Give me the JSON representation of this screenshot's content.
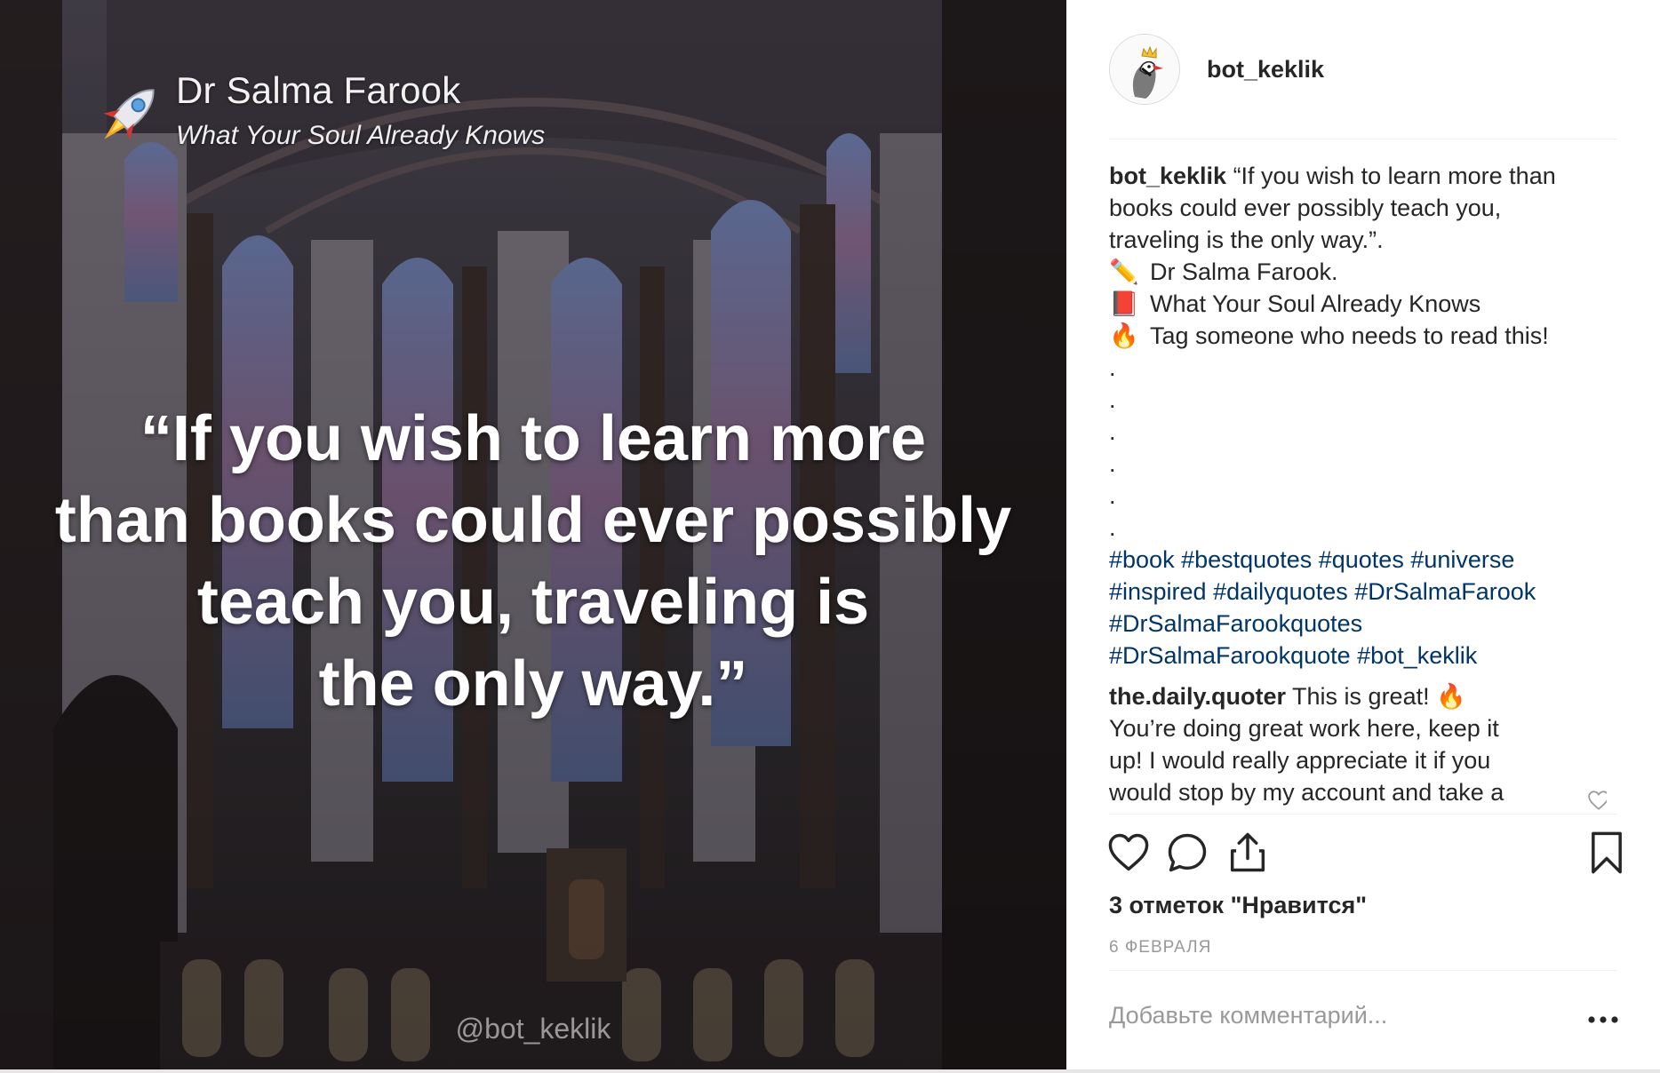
{
  "image": {
    "overlay_author": "Dr Salma Farook",
    "overlay_book": "What Your Soul Already Knows",
    "overlay_quote_lines": [
      "“If you wish to learn more",
      "than books could ever possibly",
      "teach you, traveling is",
      "the only way.”"
    ],
    "watermark": "@bot_keklik",
    "icon": "rocket-icon"
  },
  "post": {
    "header": {
      "username": "bot_keklik",
      "avatar_icon": "partridge-with-crown-avatar"
    },
    "caption": {
      "username": "bot_keklik",
      "text_lines": [
        " “If you wish to learn more than",
        "books could ever possibly teach you,",
        "traveling is the only way.”."
      ],
      "detail_lines": [
        {
          "emoji": "✏️",
          "text": "Dr Salma Farook."
        },
        {
          "emoji": "📕",
          "text": "What Your Soul Already Knows"
        },
        {
          "emoji": "🔥",
          "text": "Tag someone who needs to read this!"
        }
      ],
      "dots": [
        ".",
        ".",
        ".",
        ".",
        ".",
        "."
      ],
      "hashtags": [
        "#book",
        "#bestquotes",
        "#quotes",
        "#universe",
        "#inspired",
        "#dailyquotes",
        "#DrSalmaFarook",
        "#DrSalmaFarookquotes",
        "#DrSalmaFarookquote",
        "#bot_keklik"
      ]
    },
    "comment": {
      "username": "the.daily.quoter",
      "text_lines": [
        " This is great! 🔥",
        "You’re doing great work here, keep it",
        "up! I would really appreciate it if you",
        "would stop by my account and take a"
      ]
    },
    "likes": "3 отметок \"Нравится\"",
    "date": "6 ФЕВРАЛЯ",
    "comment_input": {
      "placeholder": "Добавьте комментарий...",
      "value": ""
    },
    "colors": {
      "hashtag": "#003569",
      "muted": "#999999",
      "text": "#262626"
    }
  }
}
